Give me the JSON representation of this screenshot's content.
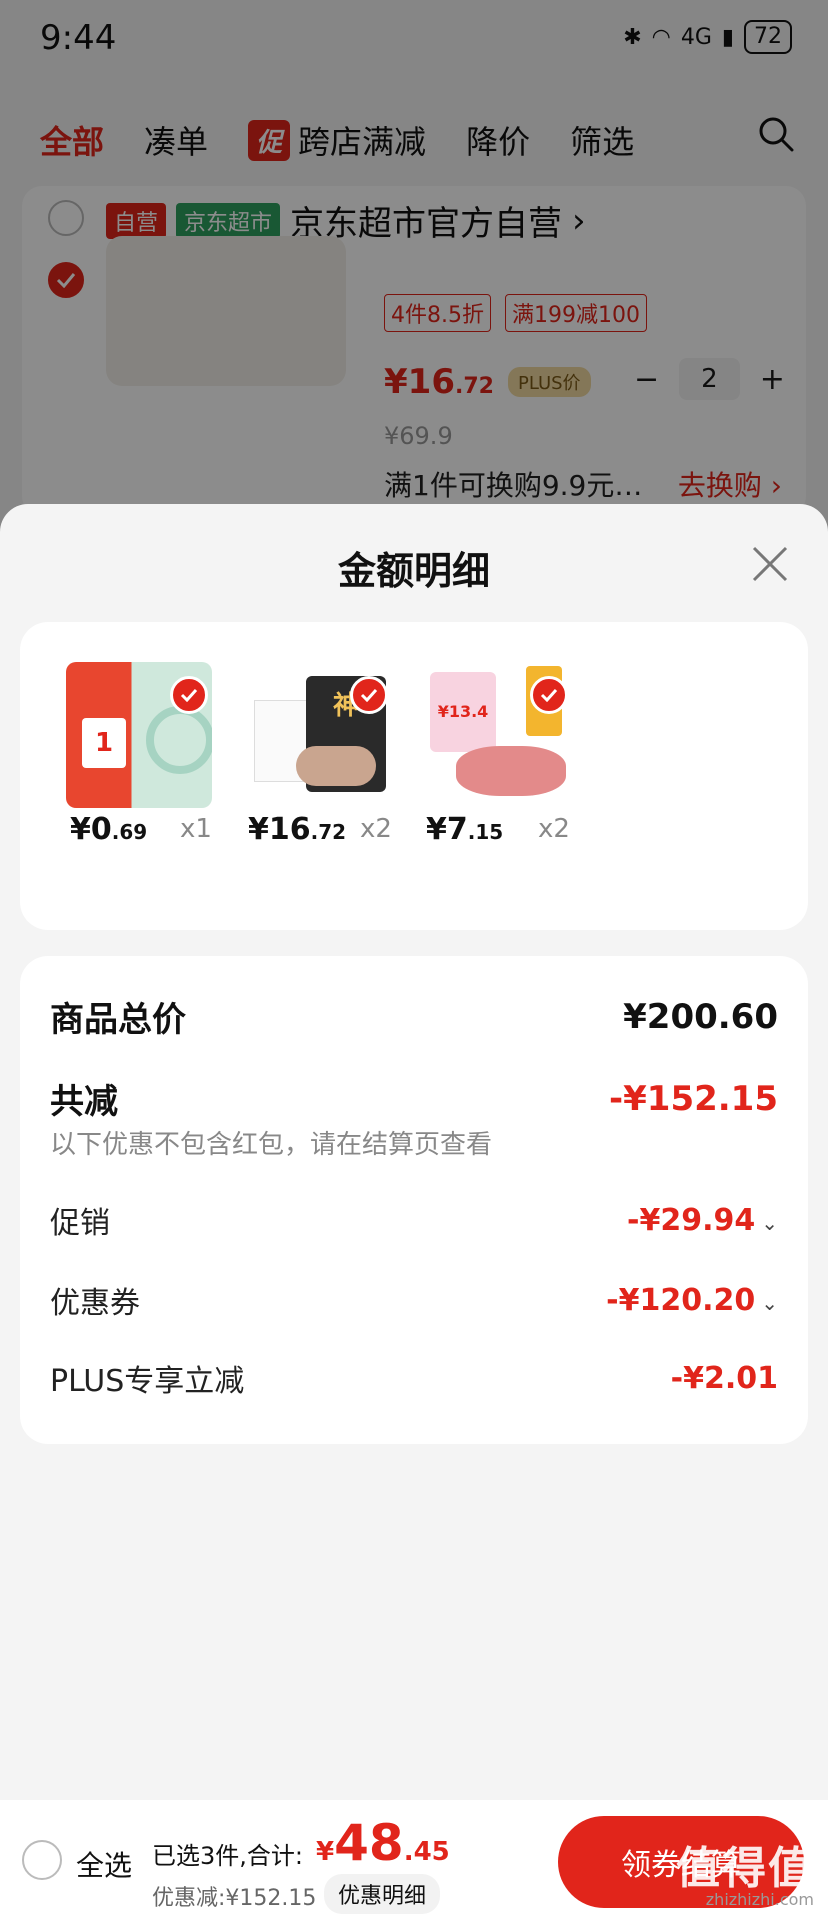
{
  "status_bar": {
    "time": "9:44",
    "battery": "72",
    "network": "4G"
  },
  "tabs": [
    {
      "label": "全部",
      "active": true
    },
    {
      "label": "凑单",
      "active": false
    },
    {
      "label": "跨店满减",
      "badge": "促",
      "active": false
    },
    {
      "label": "降价",
      "active": false
    },
    {
      "label": "筛选",
      "active": false
    }
  ],
  "cart": {
    "tag_self": "自营",
    "tag_super": "京东超市",
    "store_name": "京东超市官方自营",
    "promo1": "4件8.5折",
    "promo2": "满199减100",
    "price_int": "¥16",
    "price_dec": ".72",
    "plus_tag": "PLUS价",
    "original_price": "¥69.9",
    "quantity": "2",
    "exchange_text": "满1件可换购9.9元…",
    "exchange_link": "去换购"
  },
  "sheet": {
    "title": "金额明细",
    "products": [
      {
        "price_int": "¥0",
        "price_dec": ".69",
        "qty": "x1",
        "thumb_text": "1"
      },
      {
        "price_int": "¥16",
        "price_dec": ".72",
        "qty": "x2",
        "thumb_text": "神"
      },
      {
        "price_int": "¥7",
        "price_dec": ".15",
        "qty": "x2",
        "thumb_text": "¥13.4"
      }
    ],
    "summary": {
      "total_label": "商品总价",
      "total_value": "¥200.60",
      "reduce_label": "共减",
      "reduce_value": "-¥152.15",
      "reduce_note": "以下优惠不包含红包，请在结算页查看",
      "promo_label": "促销",
      "promo_value": "-¥29.94",
      "coupon_label": "优惠券",
      "coupon_value": "-¥120.20",
      "plus_label": "PLUS专享立减",
      "plus_value": "-¥2.01"
    }
  },
  "bottom_bar": {
    "select_all": "全选",
    "selected_text": "已选3件,合计:",
    "total_currency": "¥",
    "total_int": "48",
    "total_dec": ".45",
    "discount_text": "优惠减:¥152.15",
    "detail_button": "优惠明细",
    "checkout_button": "领券结算"
  },
  "watermark": "值得值",
  "watermark_url": "zhizhizhi.com",
  "colors": {
    "accent": "#e1251b",
    "green": "#2ea160"
  }
}
